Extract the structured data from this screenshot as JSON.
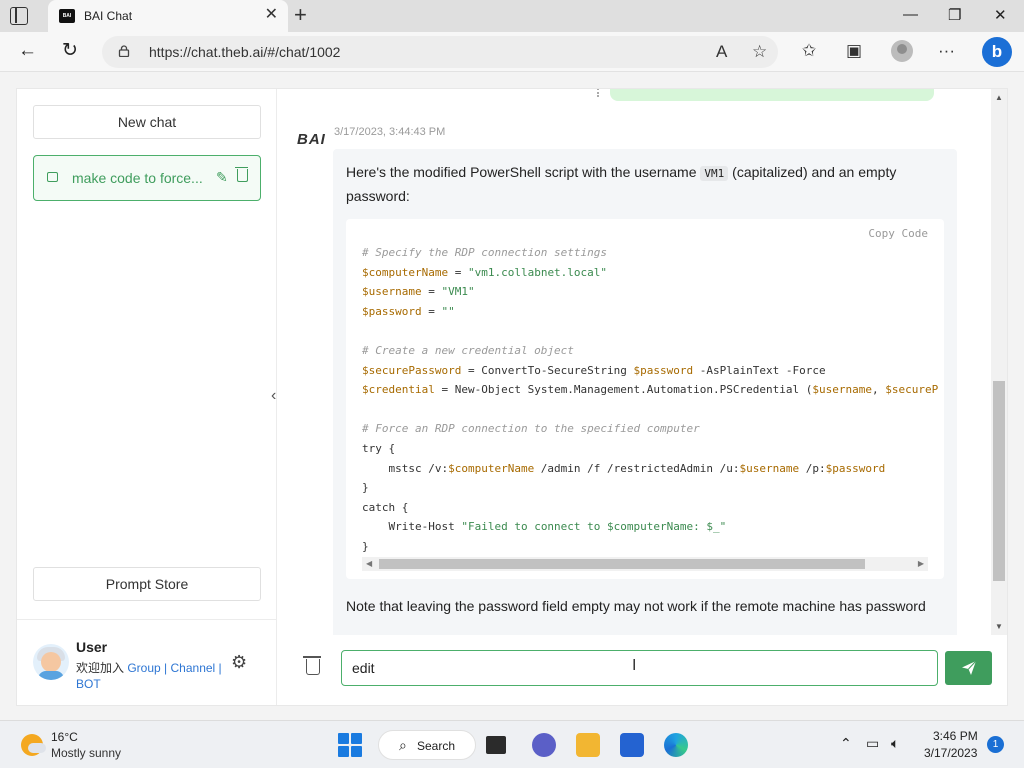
{
  "browser": {
    "tab_title": "BAI Chat",
    "tab_favicon_text": "BAI",
    "url": "https://chat.theb.ai/#/chat/1002",
    "window_controls": {
      "minimize": "—",
      "restore": "❐",
      "close": "✕"
    }
  },
  "sidebar": {
    "new_chat": "New chat",
    "history": [
      {
        "label": "make code to force..."
      }
    ],
    "prompt_store": "Prompt Store",
    "user": {
      "name": "User",
      "line_prefix": "欢迎加入 ",
      "link_group": "Group",
      "separator": " | ",
      "link_channel": "Channel",
      "link_bot": "BOT"
    }
  },
  "chat": {
    "bot_label": "BAI",
    "timestamp": "3/17/2023, 3:44:43 PM",
    "intro_before": "Here's the modified PowerShell script with the username ",
    "intro_code": "VM1",
    "intro_after": " (capitalized) and an empty password:",
    "copy_code": "Copy Code",
    "code": {
      "c1": "# Specify the RDP connection settings",
      "computerName_var": "$computerName",
      "computerName_val": "\"vm1.collabnet.local\"",
      "username_var": "$username",
      "username_val": "\"VM1\"",
      "password_var": "$password",
      "password_val": "\"\"",
      "c2": "# Create a new credential object",
      "securePassword_var": "$securePassword",
      "securePassword_cmd": " = ConvertTo-SecureString ",
      "securePassword_arg": "$password",
      "securePassword_tail": " -AsPlainText -Force",
      "credential_var": "$credential",
      "credential_cmd": " = New-Object System.Management.Automation.PSCredential (",
      "credential_arg1": "$username",
      "credential_sep": ", ",
      "credential_arg2": "$secureP",
      "c3": "# Force an RDP connection to the specified computer",
      "try_open": "try {",
      "mstsc_pre": "    mstsc /v:",
      "mstsc_var1": "$computerName",
      "mstsc_mid": " /admin /f /restrictedAdmin /u:",
      "mstsc_var2": "$username",
      "mstsc_mid2": " /p:",
      "mstsc_var3": "$password",
      "try_close": "}",
      "catch_open": "catch {",
      "write_pre": "    Write-Host ",
      "write_str": "\"Failed to connect to $computerName: $_\"",
      "catch_close": "}"
    },
    "note": "Note that leaving the password field empty may not work if the remote machine has password"
  },
  "composer": {
    "value": "edit "
  },
  "taskbar": {
    "temperature": "16°C",
    "condition": "Mostly sunny",
    "search_label": "Search",
    "time": "3:46 PM",
    "date": "3/17/2023",
    "notifications": "1"
  },
  "colors": {
    "accent": "#3f9d5d",
    "link": "#2e76d3"
  }
}
